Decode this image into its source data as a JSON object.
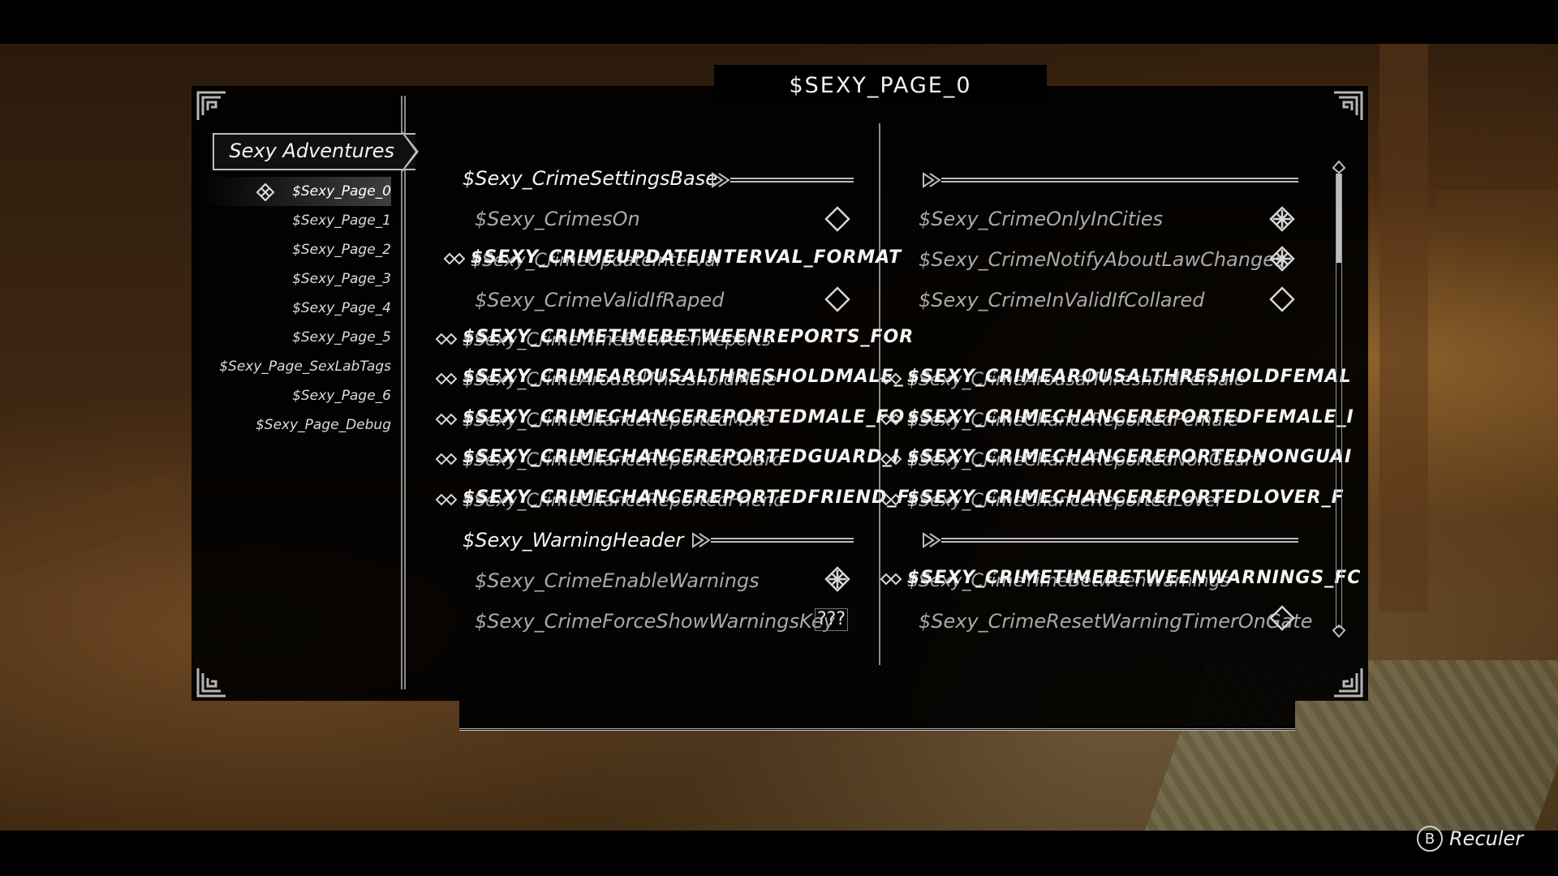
{
  "page_title": "$SEXY_PAGE_0",
  "sidebar": {
    "mod_title": "Sexy Adventures",
    "pages": [
      {
        "label": "$Sexy_Page_0",
        "active": true
      },
      {
        "label": "$Sexy_Page_1",
        "active": false
      },
      {
        "label": "$Sexy_Page_2",
        "active": false
      },
      {
        "label": "$Sexy_Page_3",
        "active": false
      },
      {
        "label": "$Sexy_Page_4",
        "active": false
      },
      {
        "label": "$Sexy_Page_5",
        "active": false
      },
      {
        "label": "$Sexy_Page_SexLabTags",
        "active": false
      },
      {
        "label": "$Sexy_Page_6",
        "active": false
      },
      {
        "label": "$Sexy_Page_Debug",
        "active": false
      }
    ]
  },
  "left_column": {
    "header1": "$Sexy_CrimeSettingsBase",
    "crimes_on": "$Sexy_CrimesOn",
    "update_interval": "$SEXY_CRIMEUPDATEINTERVAL_FORMAT",
    "update_interval_ghost": "$Sexy_CrimeUpdateInterval",
    "valid_if_raped": "$Sexy_CrimeValidIfRaped",
    "time_between_reports": "$SEXY_CRIMETIMEBETWEENREPORTS_FOR",
    "time_between_reports_ghost": "$Sexy_CrimeTimeBetweenReports",
    "arousal_male": "$SEXY_CRIMEAROUSALTHRESHOLDMALE_",
    "arousal_male_ghost": "$Sexy_CrimeArousalThresholdMale",
    "chance_male": "$SEXY_CRIMECHANCEREPORTEDMALE_FO",
    "chance_male_ghost": "$Sexy_CrimeChanceReportedMale",
    "chance_guard": "$SEXY_CRIMECHANCEREPORTEDGUARD_I",
    "chance_guard_ghost": "$Sexy_CrimeChanceReportedGuard",
    "chance_friend": "$SEXY_CRIMECHANCEREPORTEDFRIEND_F",
    "chance_friend_ghost": "$Sexy_CrimeChanceReportedFriend",
    "header2": "$Sexy_WarningHeader",
    "enable_warnings": "$Sexy_CrimeEnableWarnings",
    "force_show_key": "$Sexy_CrimeForceShowWarningsKey",
    "key_value": "???"
  },
  "right_column": {
    "only_in_cities": "$Sexy_CrimeOnlyInCities",
    "notify_law": "$Sexy_CrimeNotifyAboutLawChanges",
    "invalid_collared": "$Sexy_CrimeInValidIfCollared",
    "arousal_female": "$SEXY_CRIMEAROUSALTHRESHOLDFEMAL",
    "arousal_female_ghost": "$Sexy_CrimeArousalThresholdFemale",
    "chance_female": "$SEXY_CRIMECHANCEREPORTEDFEMALE_I",
    "chance_female_ghost": "$Sexy_CrimeChanceReportedFemale",
    "chance_nonguard": "$SEXY_CRIMECHANCEREPORTEDNONGUAI",
    "chance_nonguard_ghost": "$Sexy_CrimeChanceReportedNonGuard",
    "chance_lover": "$SEXY_CRIMECHANCEREPORTEDLOVER_F",
    "chance_lover_ghost": "$Sexy_CrimeChanceReportedLover",
    "time_between_warnings": "$SEXY_CRIMETIMEBETWEENWARNINGS_FC",
    "time_between_warnings_ghost": "$Sexy_CrimeTimeBetweenWarnings",
    "reset_warning_timer": "$Sexy_CrimeResetWarningTimerOnGate"
  },
  "toggles": {
    "crimes_on": false,
    "valid_if_raped": false,
    "enable_warnings": true,
    "only_in_cities": true,
    "notify_law": true,
    "invalid_collared": false,
    "reset_warning_timer": false
  },
  "back_hint": {
    "button": "B",
    "label": "Reculer"
  }
}
